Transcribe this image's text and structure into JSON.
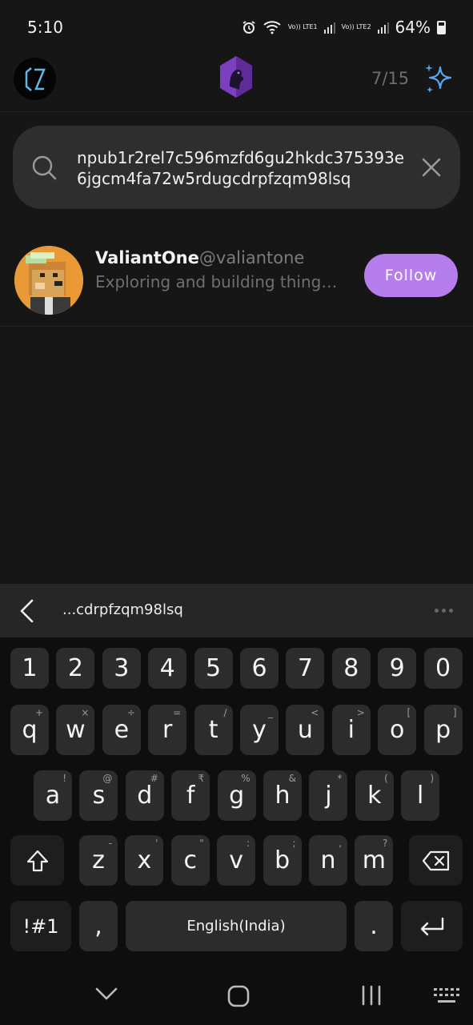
{
  "status_bar": {
    "time": "5:10",
    "sim1_label": "Vo)) LTE1",
    "sim2_label": "Vo)) LTE2",
    "battery": "64%"
  },
  "header": {
    "counter": "7/15",
    "icons": {
      "profile": "profile-avatar",
      "logo": "app-logo",
      "ai": "sparkle-icon"
    }
  },
  "search": {
    "value": "npub1r2rel7c596mzfd6gu2hkdc375393e6jgcm4fa72w5rdugcdrpfzqm98lsq"
  },
  "results": [
    {
      "name": "ValiantOne",
      "handle": "@valiantone",
      "bio": "Exploring and building things i...",
      "follow_label": "Follow"
    }
  ],
  "keyboard": {
    "suggestion": "...cdrpfzqm98lsq",
    "number_row": [
      "1",
      "2",
      "3",
      "4",
      "5",
      "6",
      "7",
      "8",
      "9",
      "0"
    ],
    "row1": [
      {
        "k": "q",
        "s": "+"
      },
      {
        "k": "w",
        "s": "×"
      },
      {
        "k": "e",
        "s": "÷"
      },
      {
        "k": "r",
        "s": "="
      },
      {
        "k": "t",
        "s": "/"
      },
      {
        "k": "y",
        "s": "_"
      },
      {
        "k": "u",
        "s": "<"
      },
      {
        "k": "i",
        "s": ">"
      },
      {
        "k": "o",
        "s": "["
      },
      {
        "k": "p",
        "s": "]"
      }
    ],
    "row2": [
      {
        "k": "a",
        "s": "!"
      },
      {
        "k": "s",
        "s": "@"
      },
      {
        "k": "d",
        "s": "#"
      },
      {
        "k": "f",
        "s": "₹"
      },
      {
        "k": "g",
        "s": "%"
      },
      {
        "k": "h",
        "s": "&"
      },
      {
        "k": "j",
        "s": "*"
      },
      {
        "k": "k",
        "s": "("
      },
      {
        "k": "l",
        "s": ")"
      }
    ],
    "row3": [
      {
        "k": "z",
        "s": "-"
      },
      {
        "k": "x",
        "s": "'"
      },
      {
        "k": "c",
        "s": "\""
      },
      {
        "k": "v",
        "s": ":"
      },
      {
        "k": "b",
        "s": ";"
      },
      {
        "k": "n",
        "s": ","
      },
      {
        "k": "m",
        "s": "?"
      }
    ],
    "symbols_label": "!#1",
    "comma_label": ",",
    "space_label": "English(India)",
    "period_label": "."
  },
  "colors": {
    "accent": "#b57eec",
    "background": "#161616",
    "search_bg": "#2e2e2e",
    "sparkle": "#5aa6f0"
  }
}
